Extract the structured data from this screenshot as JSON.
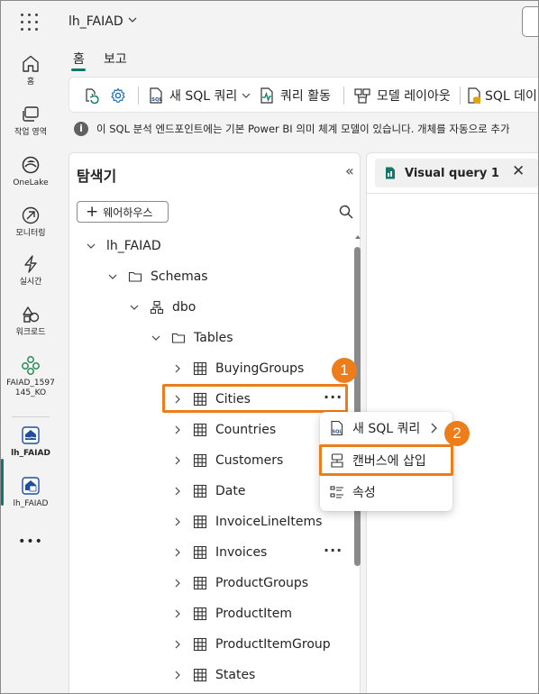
{
  "topbar": {
    "workspace_name": "lh_FAIAD",
    "chevron": "⌵"
  },
  "rail": {
    "items": [
      {
        "label": "홈",
        "icon": "home-icon"
      },
      {
        "label": "작업 영역",
        "icon": "workspaces-icon"
      },
      {
        "label": "OneLake",
        "icon": "onelake-icon"
      },
      {
        "label": "모니터링",
        "icon": "monitor-icon"
      },
      {
        "label": "실시간",
        "icon": "realtime-icon"
      },
      {
        "label": "워크로드",
        "icon": "workloads-icon"
      },
      {
        "label": "FAIAD_1597 145_KO",
        "icon": "workspace-icon"
      },
      {
        "label": "lh_FAIAD",
        "icon": "lakehouse-icon"
      },
      {
        "label": "lh_FAIAD",
        "icon": "sql-endpoint-icon"
      }
    ],
    "more": "•••"
  },
  "tabs": {
    "home": "홈",
    "report": "보고"
  },
  "ribbon": {
    "new_sql_query": "새 SQL 쿼리",
    "query_activity": "쿼리 활동",
    "model_layout": "모델 레이아웃",
    "sql_db": "SQL 데이"
  },
  "infobar": {
    "text": "이 SQL 분석 엔드포인트에는 기본 Power BI 의미 체계 모델이 있습니다. 개체를 자동으로 추가"
  },
  "explorer": {
    "title": "탐색기",
    "collapse": "«",
    "warehouse_button": "웨어하우스",
    "tree": {
      "root": "lh_FAIAD",
      "schemas": "Schemas",
      "dbo": "dbo",
      "tables_folder": "Tables",
      "tables": [
        "BuyingGroups",
        "Cities",
        "Countries",
        "Customers",
        "Date",
        "InvoiceLineItems",
        "Invoices",
        "ProductGroups",
        "ProductItem",
        "ProductItemGroup",
        "States"
      ]
    },
    "more": "···"
  },
  "context_menu": {
    "new_sql_query": "새 SQL 쿼리",
    "insert_canvas": "캔버스에 삽입",
    "properties": "속성",
    "submenu_chevron": "›"
  },
  "badges": {
    "one": "1",
    "two": "2"
  },
  "query_tab": {
    "label": "Visual query 1",
    "close": "✕"
  },
  "colors": {
    "accent": "#117865",
    "highlight": "#ed7d1a"
  }
}
